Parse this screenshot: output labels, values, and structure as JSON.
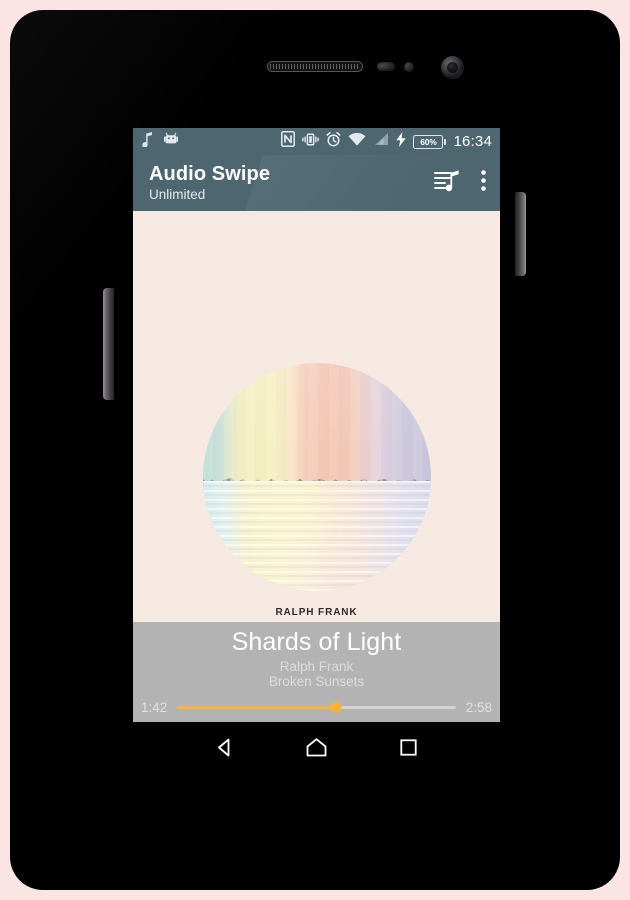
{
  "device": {
    "name": "android-phone",
    "hardware": {
      "earpiece": "earpiece-speaker",
      "camera": "front-camera",
      "sensor_proximity": "proximity-sensor",
      "sensor_light": "light-sensor",
      "button_volume": "volume-rocker",
      "button_power": "power-button"
    }
  },
  "statusbar": {
    "left_icons": [
      "music-note-icon",
      "android-robot-icon"
    ],
    "right_icons": [
      "nfc-icon",
      "vibrate-icon",
      "alarm-icon",
      "wifi-icon",
      "signal-icon",
      "charging-bolt-icon"
    ],
    "battery_percent": "60%",
    "clock": "16:34",
    "background": "#4d6670"
  },
  "appbar": {
    "title": "Audio Swipe",
    "subtitle": "Unlimited",
    "actions": [
      {
        "name": "queue-music-icon",
        "label": "Queue"
      },
      {
        "name": "overflow-menu-icon",
        "label": "More options"
      }
    ],
    "background": "#4d6670"
  },
  "album": {
    "artwork_name": "album-artwork-broken-sunsets",
    "artist": "RALPH FRANK",
    "title": "BROKEN SUNSETS",
    "background": "#f5e9e2",
    "palette": [
      "#bfded8",
      "#f4efc0",
      "#f5c6b4",
      "#c9c6dd"
    ]
  },
  "player": {
    "track_title": "Shards of Light",
    "artist": "Ralph Frank",
    "album": "Broken Sunsets",
    "elapsed": "1:42",
    "duration": "2:58",
    "progress_percent": 57,
    "accent_color": "#f9b233",
    "background": "#b3b3b3"
  },
  "navbar": {
    "buttons": [
      {
        "name": "nav-back-button",
        "label": "Back"
      },
      {
        "name": "nav-home-button",
        "label": "Home"
      },
      {
        "name": "nav-recents-button",
        "label": "Recents"
      }
    ]
  }
}
